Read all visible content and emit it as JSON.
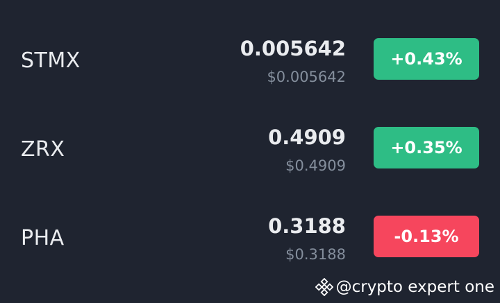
{
  "rows": [
    {
      "symbol": "STMX",
      "price": "0.005642",
      "fiat": "$0.005642",
      "change": "+0.43%",
      "direction": "up"
    },
    {
      "symbol": "ZRX",
      "price": "0.4909",
      "fiat": "$0.4909",
      "change": "+0.35%",
      "direction": "up"
    },
    {
      "symbol": "PHA",
      "price": "0.3188",
      "fiat": "$0.3188",
      "change": "-0.13%",
      "direction": "down"
    }
  ],
  "colors": {
    "background": "#1f2430",
    "up": "#2ebd85",
    "down": "#f6465d",
    "primary_text": "#eaecef",
    "secondary_text": "#848e9c"
  },
  "watermark": {
    "icon": "binance-logo-icon",
    "text": "@crypto expert one"
  }
}
